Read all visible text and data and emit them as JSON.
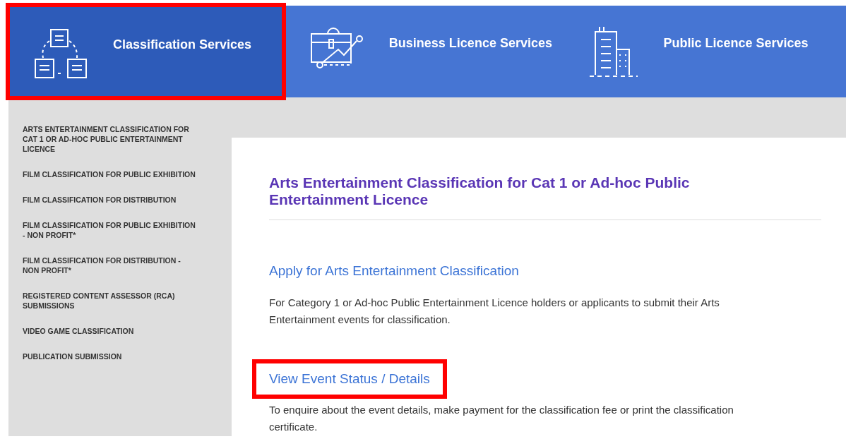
{
  "tabs": [
    {
      "label": "Classification Services",
      "selected": true,
      "highlighted": true
    },
    {
      "label": "Business Licence Services",
      "selected": false,
      "highlighted": false
    },
    {
      "label": "Public Licence Services",
      "selected": false,
      "highlighted": false
    }
  ],
  "sidebar": {
    "items": [
      "ARTS ENTERTAINMENT CLASSIFICATION FOR CAT 1 OR AD-HOC PUBLIC ENTERTAINMENT LICENCE",
      "FILM CLASSIFICATION FOR PUBLIC EXHIBITION",
      "FILM CLASSIFICATION FOR DISTRIBUTION",
      "FILM CLASSIFICATION FOR PUBLIC EXHIBITION - NON PROFIT*",
      "FILM CLASSIFICATION FOR DISTRIBUTION - NON PROFIT*",
      "REGISTERED CONTENT ASSESSOR (RCA) SUBMISSIONS",
      "VIDEO GAME CLASSIFICATION",
      "PUBLICATION SUBMISSION"
    ]
  },
  "content": {
    "title": "Arts Entertainment Classification for Cat 1 or Ad-hoc Public Entertainment Licence",
    "sections": [
      {
        "link": "Apply for Arts Entertainment Classification",
        "text": "For Category 1 or Ad-hoc Public Entertainment Licence holders or applicants to submit their Arts Entertainment events for classification.",
        "highlighted": false
      },
      {
        "link": "View Event Status / Details",
        "text": "To enquire about the event details, make payment for the classification fee or print the classification certificate.",
        "highlighted": true
      }
    ]
  }
}
